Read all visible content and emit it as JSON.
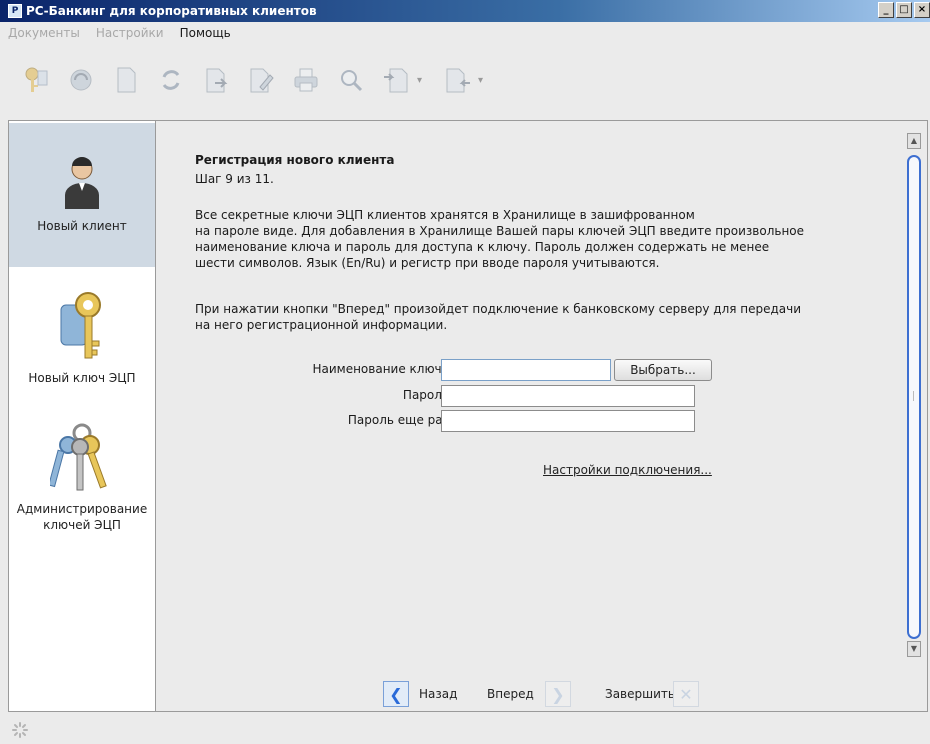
{
  "window": {
    "title": "РС-Банкинг для корпоративных клиентов",
    "app_icon": "bank-app-icon",
    "controls": [
      "_",
      "□",
      "×"
    ]
  },
  "menu": [
    {
      "label": "Документы",
      "enabled": false
    },
    {
      "label": "Настройки",
      "enabled": false
    },
    {
      "label": "Помощь",
      "enabled": true
    }
  ],
  "toolbar": {
    "icons": [
      "keys-icon",
      "refresh-document-icon",
      "document-icon",
      "sync-icon",
      "document-arrow-icon",
      "edit-document-icon",
      "print-icon",
      "search-icon",
      "send-document-icon",
      "receive-document-icon"
    ]
  },
  "sidebar": {
    "items": [
      {
        "label": "Новый клиент",
        "icon": "person-icon",
        "active": true
      },
      {
        "label": "Новый ключ ЭЦП",
        "icon": "key-icon",
        "active": false
      },
      {
        "label": "Администрирование\nключей ЭЦП",
        "icon": "keys-bundle-icon",
        "active": false
      }
    ]
  },
  "wizard": {
    "title": "Регистрация нового клиента",
    "step": "Шаг 9 из 11.",
    "paragraph1": "Все секретные ключи ЭЦП клиентов хранятся в Хранилище в зашифрованном\nна пароле виде. Для добавления в Хранилище Вашей пары ключей ЭЦП введите произвольное\nнаименование ключа и пароль для доступа к ключу. Пароль должен содержать не менее\nшести символов. Язык (En/Ru) и регистр при вводе пароля учитываются.",
    "paragraph2": "При нажатии кнопки \"Вперед\" произойдет подключение к банковскому серверу для передачи\nна него регистрационной информации.",
    "form": {
      "key_name_label": "Наименование ключа",
      "key_name_value": "",
      "choose_button": "Выбрать...",
      "password_label": "Пароль",
      "password_value": "",
      "password_repeat_label": "Пароль еще раз",
      "password_repeat_value": ""
    },
    "connection_settings_link": "Настройки подключения..."
  },
  "nav": {
    "back": "Назад",
    "forward": "Вперед",
    "finish": "Завершить"
  }
}
